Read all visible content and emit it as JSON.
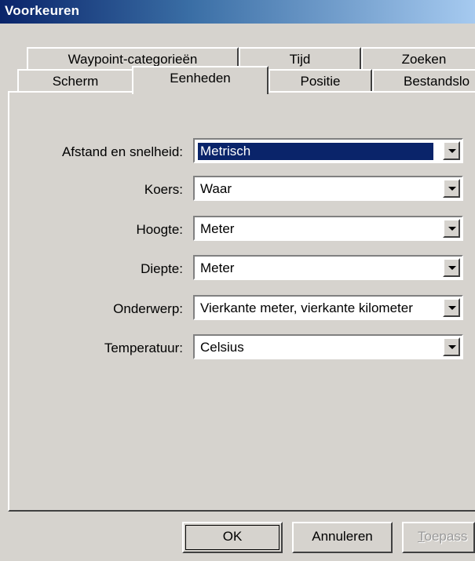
{
  "window": {
    "title": "Voorkeuren"
  },
  "tabs": {
    "back_row": [
      "Waypoint-categorieën",
      "Tijd",
      "Zoeken"
    ],
    "front_row": [
      "Scherm",
      "Eenheden",
      "Positie",
      "Bestandslo"
    ],
    "active": "Eenheden"
  },
  "fields": [
    {
      "label": "Afstand en snelheid:",
      "value": "Metrisch",
      "selected": true
    },
    {
      "label": "Koers:",
      "value": "Waar"
    },
    {
      "label": "Hoogte:",
      "value": "Meter"
    },
    {
      "label": "Diepte:",
      "value": "Meter"
    },
    {
      "label": "Onderwerp:",
      "value": "Vierkante meter, vierkante kilometer"
    },
    {
      "label": "Temperatuur:",
      "value": "Celsius"
    }
  ],
  "buttons": {
    "ok": "OK",
    "cancel": "Annuleren",
    "apply_first": "T",
    "apply_rest": "oepass"
  },
  "colors": {
    "face": "#d6d3ce",
    "selection": "#0a246a",
    "title_start": "#0a246a"
  }
}
